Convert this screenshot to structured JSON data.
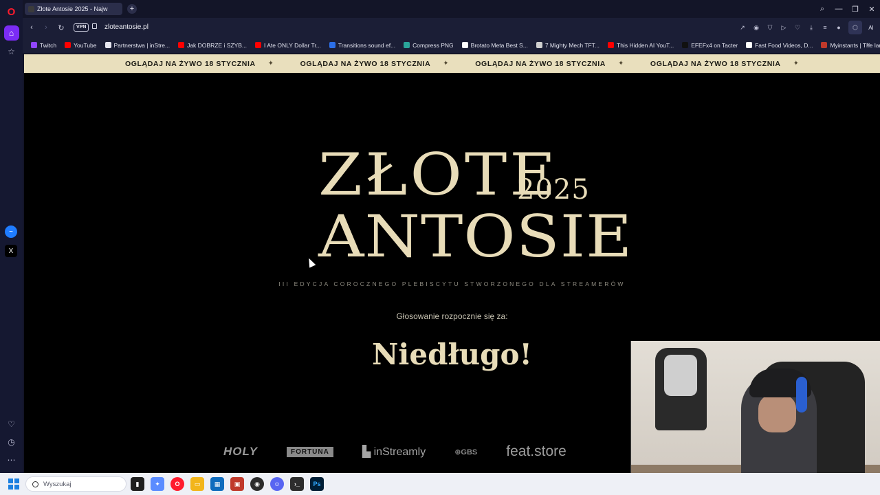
{
  "browser": {
    "tab_title": "Złote Antosie 2025 - Najw",
    "new_tab": "+",
    "url": "zloteantosie.pl",
    "vpn_label": "VPN",
    "ai_label": "AI"
  },
  "bookmarks": [
    {
      "label": "Twitch",
      "color": "#9146ff"
    },
    {
      "label": "YouTube",
      "color": "#ff0000"
    },
    {
      "label": "Partnerstwa | inStre...",
      "color": "#e6e6f0"
    },
    {
      "label": "Jak DOBRZE i SZYB...",
      "color": "#ff0000"
    },
    {
      "label": "I Ate ONLY Dollar Tr...",
      "color": "#ff0000"
    },
    {
      "label": "Transitions sound ef...",
      "color": "#2c6fe8"
    },
    {
      "label": "Compress PNG",
      "color": "#2aa59a"
    },
    {
      "label": "Brotato Meta Best S...",
      "color": "#ffffff"
    },
    {
      "label": "7 Mighty Mech TFT...",
      "color": "#cfcfcf"
    },
    {
      "label": "This Hidden AI YouT...",
      "color": "#ff0000"
    },
    {
      "label": "EFEFx4 on Tacter",
      "color": "#111111"
    },
    {
      "label": "Fast Food Videos, D...",
      "color": "#ffffff"
    },
    {
      "label": "Myinstants | The lar...",
      "color": "#c0392b"
    }
  ],
  "ticker": {
    "items": [
      "OGLĄDAJ NA ŻYWO 18 STYCZNIA",
      "OGLĄDAJ NA ŻYWO 18 STYCZNIA",
      "OGLĄDAJ NA ŻYWO 18 STYCZNIA",
      "OGLĄDAJ NA ŻYWO 18 STYCZNIA"
    ],
    "separator": "✦"
  },
  "hero": {
    "logo_line1": "ZŁOTE",
    "logo_year": "2025",
    "logo_line2": "ANTOSIE",
    "subtitle": "III EDYCJA COROCZNEGO PLEBISCYTU STWORZONEGO DLA STREAMERÓW",
    "vote_label": "Głosowanie rozpocznie się za:",
    "countdown": "Niedługo!"
  },
  "sponsors": [
    "HOLY",
    "FORTUNA",
    "inStreamly",
    "GBS",
    "feat.store"
  ],
  "taskbar": {
    "search_placeholder": "Wyszukaj",
    "apps": [
      {
        "name": "task-view",
        "color": "#1f1f1f"
      },
      {
        "name": "copilot",
        "color": "#5b8cff"
      },
      {
        "name": "opera",
        "color": "#ff1b2d"
      },
      {
        "name": "file-explorer",
        "color": "#f2b51b"
      },
      {
        "name": "store",
        "color": "#0f6cbd"
      },
      {
        "name": "app-red",
        "color": "#c0392b"
      },
      {
        "name": "obs",
        "color": "#2b2b2b"
      },
      {
        "name": "discord",
        "color": "#5865f2"
      },
      {
        "name": "terminal",
        "color": "#2d2d2d"
      },
      {
        "name": "photoshop",
        "color": "#001e36"
      }
    ]
  },
  "colors": {
    "gold": "#e8dcb8",
    "ticker_bg": "#e9dfbd",
    "page_bg": "#000000",
    "opera_accent": "#7b2cf5"
  }
}
